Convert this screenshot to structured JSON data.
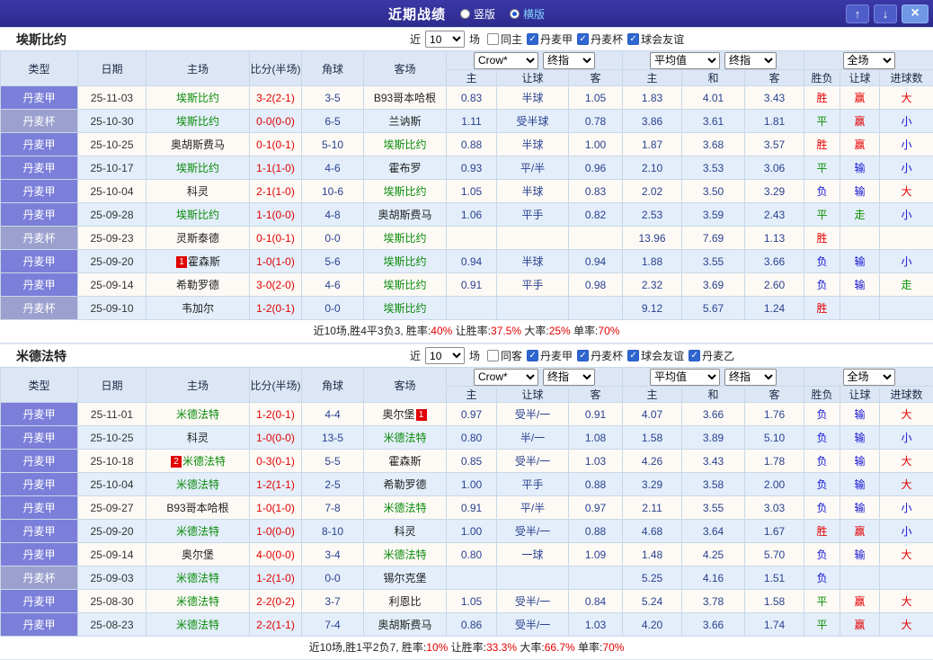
{
  "titlebar": {
    "title": "近期战绩",
    "layout_options": [
      {
        "label": "竖版",
        "selected": false
      },
      {
        "label": "横版",
        "selected": true
      }
    ],
    "up_icon": "↑",
    "down_icon": "↓",
    "close_icon": "×"
  },
  "columns": {
    "type": "类型",
    "date": "日期",
    "home": "主场",
    "score": "比分(半场)",
    "corner": "角球",
    "away": "客场",
    "odds_sub": [
      "主",
      "让球",
      "客",
      "主",
      "和",
      "客"
    ],
    "result": "胜负",
    "handicap": "让球",
    "goals": "进球数"
  },
  "sections": [
    {
      "team": "埃斯比约",
      "near_label": "近",
      "near_value": "10",
      "games_label": "场",
      "checkboxes": [
        {
          "label": "同主",
          "checked": false
        },
        {
          "label": "丹麦甲",
          "checked": true
        },
        {
          "label": "丹麦杯",
          "checked": true
        },
        {
          "label": "球会友谊",
          "checked": true
        }
      ],
      "selects": {
        "bookmaker": "Crow*",
        "final1": "终指",
        "average": "平均值",
        "final2": "终指",
        "scope": "全场"
      },
      "rows": [
        {
          "league": "丹麦甲",
          "is_cup": false,
          "date": "25-11-03",
          "home": {
            "name": "埃斯比约",
            "self": true
          },
          "score": "3-2(2-1)",
          "corner": "3-5",
          "away": {
            "name": "B93哥本哈根",
            "self": false
          },
          "handicap_odds": [
            "0.83",
            "半球",
            "1.05"
          ],
          "europe_odds": [
            "1.83",
            "4.01",
            "3.43"
          ],
          "result": {
            "text": "胜",
            "color": "red"
          },
          "hcp": {
            "text": "赢",
            "color": "red"
          },
          "goals": {
            "text": "大",
            "color": "red"
          }
        },
        {
          "league": "丹麦杯",
          "is_cup": true,
          "date": "25-10-30",
          "home": {
            "name": "埃斯比约",
            "self": true
          },
          "score": "0-0(0-0)",
          "corner": "6-5",
          "away": {
            "name": "兰讷斯",
            "self": false
          },
          "handicap_odds": [
            "1.11",
            "受半球",
            "0.78"
          ],
          "europe_odds": [
            "3.86",
            "3.61",
            "1.81"
          ],
          "result": {
            "text": "平",
            "color": "green"
          },
          "hcp": {
            "text": "赢",
            "color": "red"
          },
          "goals": {
            "text": "小",
            "color": "blue"
          }
        },
        {
          "league": "丹麦甲",
          "is_cup": false,
          "date": "25-10-25",
          "home": {
            "name": "奥胡斯费马",
            "self": false
          },
          "score": "0-1(0-1)",
          "corner": "5-10",
          "away": {
            "name": "埃斯比约",
            "self": true
          },
          "handicap_odds": [
            "0.88",
            "半球",
            "1.00"
          ],
          "europe_odds": [
            "1.87",
            "3.68",
            "3.57"
          ],
          "result": {
            "text": "胜",
            "color": "red"
          },
          "hcp": {
            "text": "赢",
            "color": "red"
          },
          "goals": {
            "text": "小",
            "color": "blue"
          }
        },
        {
          "league": "丹麦甲",
          "is_cup": false,
          "date": "25-10-17",
          "home": {
            "name": "埃斯比约",
            "self": true
          },
          "score": "1-1(1-0)",
          "corner": "4-6",
          "away": {
            "name": "霍布罗",
            "self": false
          },
          "handicap_odds": [
            "0.93",
            "平/半",
            "0.96"
          ],
          "europe_odds": [
            "2.10",
            "3.53",
            "3.06"
          ],
          "result": {
            "text": "平",
            "color": "green"
          },
          "hcp": {
            "text": "输",
            "color": "blue"
          },
          "goals": {
            "text": "小",
            "color": "blue"
          }
        },
        {
          "league": "丹麦甲",
          "is_cup": false,
          "date": "25-10-04",
          "home": {
            "name": "科灵",
            "self": false
          },
          "score": "2-1(1-0)",
          "corner": "10-6",
          "away": {
            "name": "埃斯比约",
            "self": true
          },
          "handicap_odds": [
            "1.05",
            "半球",
            "0.83"
          ],
          "europe_odds": [
            "2.02",
            "3.50",
            "3.29"
          ],
          "result": {
            "text": "负",
            "color": "blue"
          },
          "hcp": {
            "text": "输",
            "color": "blue"
          },
          "goals": {
            "text": "大",
            "color": "red"
          }
        },
        {
          "league": "丹麦甲",
          "is_cup": false,
          "date": "25-09-28",
          "home": {
            "name": "埃斯比约",
            "self": true
          },
          "score": "1-1(0-0)",
          "corner": "4-8",
          "away": {
            "name": "奥胡斯费马",
            "self": false
          },
          "handicap_odds": [
            "1.06",
            "平手",
            "0.82"
          ],
          "europe_odds": [
            "2.53",
            "3.59",
            "2.43"
          ],
          "result": {
            "text": "平",
            "color": "green"
          },
          "hcp": {
            "text": "走",
            "color": "green"
          },
          "goals": {
            "text": "小",
            "color": "blue"
          }
        },
        {
          "league": "丹麦杯",
          "is_cup": true,
          "date": "25-09-23",
          "home": {
            "name": "灵斯泰德",
            "self": false
          },
          "score": "0-1(0-1)",
          "corner": "0-0",
          "away": {
            "name": "埃斯比约",
            "self": true
          },
          "handicap_odds": [
            "",
            "",
            ""
          ],
          "europe_odds": [
            "13.96",
            "7.69",
            "1.13"
          ],
          "result": {
            "text": "胜",
            "color": "red"
          },
          "hcp": {
            "text": "",
            "color": ""
          },
          "goals": {
            "text": "",
            "color": ""
          }
        },
        {
          "league": "丹麦甲",
          "is_cup": false,
          "date": "25-09-20",
          "home": {
            "name": "霍森斯",
            "self": false,
            "badge": "1",
            "badge_pos": "before"
          },
          "score": "1-0(1-0)",
          "corner": "5-6",
          "away": {
            "name": "埃斯比约",
            "self": true
          },
          "handicap_odds": [
            "0.94",
            "半球",
            "0.94"
          ],
          "europe_odds": [
            "1.88",
            "3.55",
            "3.66"
          ],
          "result": {
            "text": "负",
            "color": "blue"
          },
          "hcp": {
            "text": "输",
            "color": "blue"
          },
          "goals": {
            "text": "小",
            "color": "blue"
          }
        },
        {
          "league": "丹麦甲",
          "is_cup": false,
          "date": "25-09-14",
          "home": {
            "name": "希勒罗德",
            "self": false
          },
          "score": "3-0(2-0)",
          "corner": "4-6",
          "away": {
            "name": "埃斯比约",
            "self": true
          },
          "handicap_odds": [
            "0.91",
            "平手",
            "0.98"
          ],
          "europe_odds": [
            "2.32",
            "3.69",
            "2.60"
          ],
          "result": {
            "text": "负",
            "color": "blue"
          },
          "hcp": {
            "text": "输",
            "color": "blue"
          },
          "goals": {
            "text": "走",
            "color": "green"
          }
        },
        {
          "league": "丹麦杯",
          "is_cup": true,
          "date": "25-09-10",
          "home": {
            "name": "韦加尔",
            "self": false
          },
          "score": "1-2(0-1)",
          "corner": "0-0",
          "away": {
            "name": "埃斯比约",
            "self": true
          },
          "handicap_odds": [
            "",
            "",
            ""
          ],
          "europe_odds": [
            "9.12",
            "5.67",
            "1.24"
          ],
          "result": {
            "text": "胜",
            "color": "red"
          },
          "hcp": {
            "text": "",
            "color": ""
          },
          "goals": {
            "text": "",
            "color": ""
          }
        }
      ],
      "summary": [
        {
          "t": "近10场,胜4平3负3, 胜率:",
          "red": false
        },
        {
          "t": "40%",
          "red": true
        },
        {
          "t": " 让胜率:",
          "red": false
        },
        {
          "t": "37.5%",
          "red": true
        },
        {
          "t": " 大率:",
          "red": false
        },
        {
          "t": "25%",
          "red": true
        },
        {
          "t": " 单率:",
          "red": false
        },
        {
          "t": "70%",
          "red": true
        }
      ]
    },
    {
      "team": "米德法特",
      "near_label": "近",
      "near_value": "10",
      "games_label": "场",
      "checkboxes": [
        {
          "label": "同客",
          "checked": false
        },
        {
          "label": "丹麦甲",
          "checked": true
        },
        {
          "label": "丹麦杯",
          "checked": true
        },
        {
          "label": "球会友谊",
          "checked": true
        },
        {
          "label": "丹麦乙",
          "checked": true
        }
      ],
      "selects": {
        "bookmaker": "Crow*",
        "final1": "终指",
        "average": "平均值",
        "final2": "终指",
        "scope": "全场"
      },
      "rows": [
        {
          "league": "丹麦甲",
          "is_cup": false,
          "date": "25-11-01",
          "home": {
            "name": "米德法特",
            "self": true
          },
          "score": "1-2(0-1)",
          "corner": "4-4",
          "away": {
            "name": "奥尔堡",
            "self": false,
            "badge": "1",
            "badge_pos": "after"
          },
          "handicap_odds": [
            "0.97",
            "受半/一",
            "0.91"
          ],
          "europe_odds": [
            "4.07",
            "3.66",
            "1.76"
          ],
          "result": {
            "text": "负",
            "color": "blue"
          },
          "hcp": {
            "text": "输",
            "color": "blue"
          },
          "goals": {
            "text": "大",
            "color": "red"
          }
        },
        {
          "league": "丹麦甲",
          "is_cup": false,
          "date": "25-10-25",
          "home": {
            "name": "科灵",
            "self": false
          },
          "score": "1-0(0-0)",
          "corner": "13-5",
          "away": {
            "name": "米德法特",
            "self": true
          },
          "handicap_odds": [
            "0.80",
            "半/一",
            "1.08"
          ],
          "europe_odds": [
            "1.58",
            "3.89",
            "5.10"
          ],
          "result": {
            "text": "负",
            "color": "blue"
          },
          "hcp": {
            "text": "输",
            "color": "blue"
          },
          "goals": {
            "text": "小",
            "color": "blue"
          }
        },
        {
          "league": "丹麦甲",
          "is_cup": false,
          "date": "25-10-18",
          "home": {
            "name": "米德法特",
            "self": true,
            "badge": "2",
            "badge_pos": "before"
          },
          "score": "0-3(0-1)",
          "corner": "5-5",
          "away": {
            "name": "霍森斯",
            "self": false
          },
          "handicap_odds": [
            "0.85",
            "受半/一",
            "1.03"
          ],
          "europe_odds": [
            "4.26",
            "3.43",
            "1.78"
          ],
          "result": {
            "text": "负",
            "color": "blue"
          },
          "hcp": {
            "text": "输",
            "color": "blue"
          },
          "goals": {
            "text": "大",
            "color": "red"
          }
        },
        {
          "league": "丹麦甲",
          "is_cup": false,
          "date": "25-10-04",
          "home": {
            "name": "米德法特",
            "self": true
          },
          "score": "1-2(1-1)",
          "corner": "2-5",
          "away": {
            "name": "希勒罗德",
            "self": false
          },
          "handicap_odds": [
            "1.00",
            "平手",
            "0.88"
          ],
          "europe_odds": [
            "3.29",
            "3.58",
            "2.00"
          ],
          "result": {
            "text": "负",
            "color": "blue"
          },
          "hcp": {
            "text": "输",
            "color": "blue"
          },
          "goals": {
            "text": "大",
            "color": "red"
          }
        },
        {
          "league": "丹麦甲",
          "is_cup": false,
          "date": "25-09-27",
          "home": {
            "name": "B93哥本哈根",
            "self": false
          },
          "score": "1-0(1-0)",
          "corner": "7-8",
          "away": {
            "name": "米德法特",
            "self": true
          },
          "handicap_odds": [
            "0.91",
            "平/半",
            "0.97"
          ],
          "europe_odds": [
            "2.11",
            "3.55",
            "3.03"
          ],
          "result": {
            "text": "负",
            "color": "blue"
          },
          "hcp": {
            "text": "输",
            "color": "blue"
          },
          "goals": {
            "text": "小",
            "color": "blue"
          }
        },
        {
          "league": "丹麦甲",
          "is_cup": false,
          "date": "25-09-20",
          "home": {
            "name": "米德法特",
            "self": true
          },
          "score": "1-0(0-0)",
          "corner": "8-10",
          "away": {
            "name": "科灵",
            "self": false
          },
          "handicap_odds": [
            "1.00",
            "受半/一",
            "0.88"
          ],
          "europe_odds": [
            "4.68",
            "3.64",
            "1.67"
          ],
          "result": {
            "text": "胜",
            "color": "red"
          },
          "hcp": {
            "text": "赢",
            "color": "red"
          },
          "goals": {
            "text": "小",
            "color": "blue"
          }
        },
        {
          "league": "丹麦甲",
          "is_cup": false,
          "date": "25-09-14",
          "home": {
            "name": "奥尔堡",
            "self": false
          },
          "score": "4-0(0-0)",
          "corner": "3-4",
          "away": {
            "name": "米德法特",
            "self": true
          },
          "handicap_odds": [
            "0.80",
            "一球",
            "1.09"
          ],
          "europe_odds": [
            "1.48",
            "4.25",
            "5.70"
          ],
          "result": {
            "text": "负",
            "color": "blue"
          },
          "hcp": {
            "text": "输",
            "color": "blue"
          },
          "goals": {
            "text": "大",
            "color": "red"
          }
        },
        {
          "league": "丹麦杯",
          "is_cup": true,
          "date": "25-09-03",
          "home": {
            "name": "米德法特",
            "self": true
          },
          "score": "1-2(1-0)",
          "corner": "0-0",
          "away": {
            "name": "锡尔克堡",
            "self": false
          },
          "handicap_odds": [
            "",
            "",
            ""
          ],
          "europe_odds": [
            "5.25",
            "4.16",
            "1.51"
          ],
          "result": {
            "text": "负",
            "color": "blue"
          },
          "hcp": {
            "text": "",
            "color": ""
          },
          "goals": {
            "text": "",
            "color": ""
          }
        },
        {
          "league": "丹麦甲",
          "is_cup": false,
          "date": "25-08-30",
          "home": {
            "name": "米德法特",
            "self": true
          },
          "score": "2-2(0-2)",
          "corner": "3-7",
          "away": {
            "name": "利恩比",
            "self": false
          },
          "handicap_odds": [
            "1.05",
            "受半/一",
            "0.84"
          ],
          "europe_odds": [
            "5.24",
            "3.78",
            "1.58"
          ],
          "result": {
            "text": "平",
            "color": "green"
          },
          "hcp": {
            "text": "赢",
            "color": "red"
          },
          "goals": {
            "text": "大",
            "color": "red"
          }
        },
        {
          "league": "丹麦甲",
          "is_cup": false,
          "date": "25-08-23",
          "home": {
            "name": "米德法特",
            "self": true
          },
          "score": "2-2(1-1)",
          "corner": "7-4",
          "away": {
            "name": "奥胡斯费马",
            "self": false
          },
          "handicap_odds": [
            "0.86",
            "受半/一",
            "1.03"
          ],
          "europe_odds": [
            "4.20",
            "3.66",
            "1.74"
          ],
          "result": {
            "text": "平",
            "color": "green"
          },
          "hcp": {
            "text": "赢",
            "color": "red"
          },
          "goals": {
            "text": "大",
            "color": "red"
          }
        }
      ],
      "summary": [
        {
          "t": "近10场,胜1平2负7, 胜率:",
          "red": false
        },
        {
          "t": "10%",
          "red": true
        },
        {
          "t": " 让胜率:",
          "red": false
        },
        {
          "t": "33.3%",
          "red": true
        },
        {
          "t": " 大率:",
          "red": false
        },
        {
          "t": "66.7%",
          "red": true
        },
        {
          "t": " 单率:",
          "red": false
        },
        {
          "t": "70%",
          "red": true
        }
      ]
    }
  ]
}
